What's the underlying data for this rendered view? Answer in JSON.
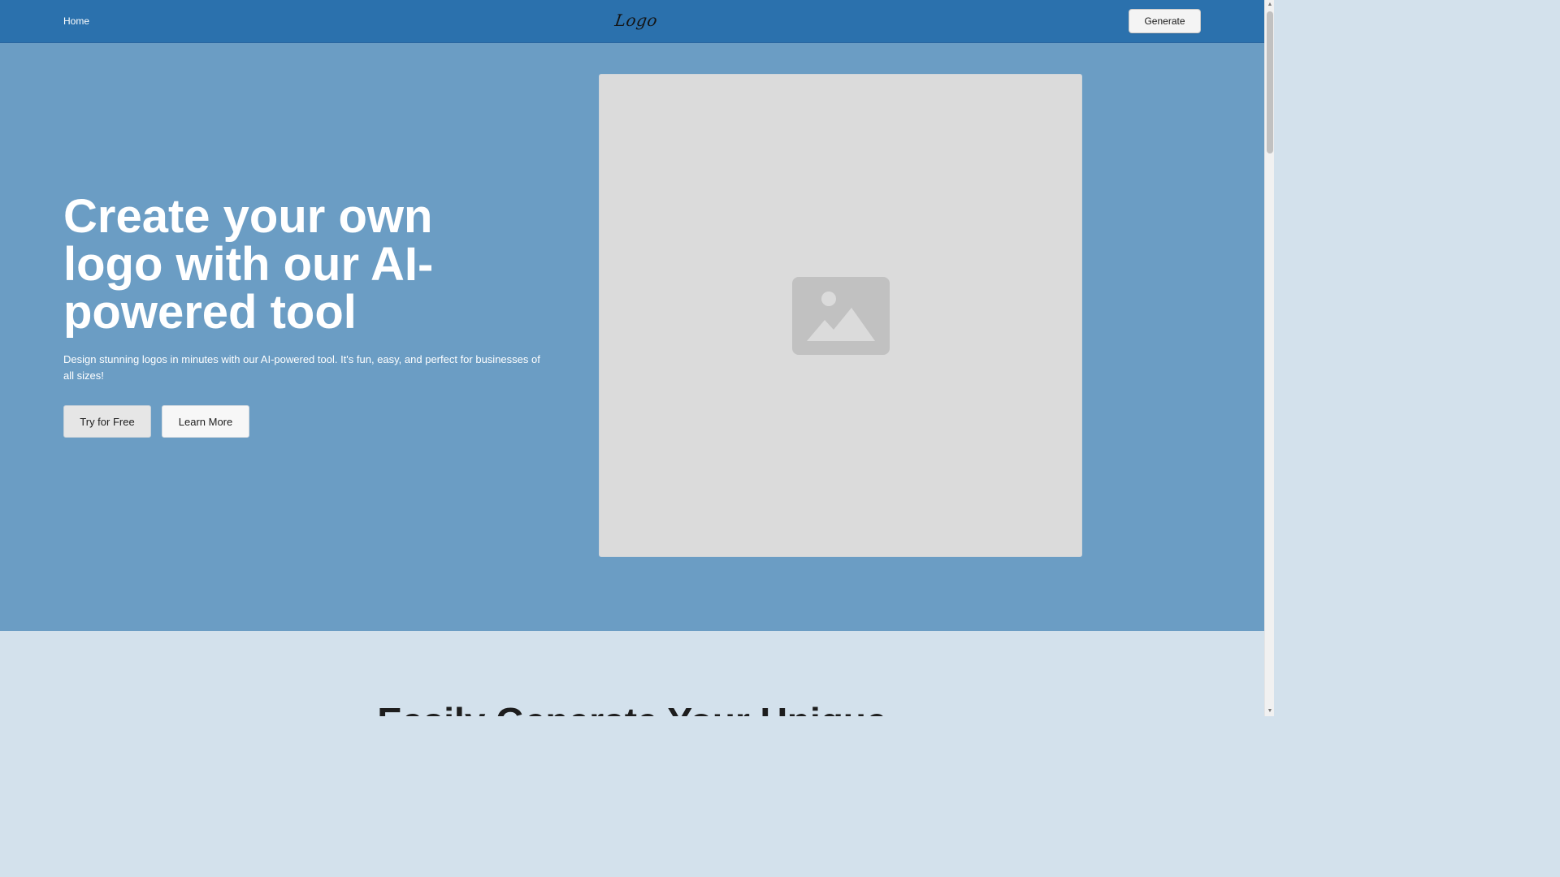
{
  "navbar": {
    "home_label": "Home",
    "logo_text": "Logo",
    "generate_label": "Generate"
  },
  "hero": {
    "title": "Create your own logo with our AI-powered tool",
    "subtitle": "Design stunning logos in minutes with our AI-powered tool. It's fun, easy, and perfect for businesses of all sizes!",
    "primary_button": "Try for Free",
    "secondary_button": "Learn More",
    "image_icon": "image-placeholder-icon"
  },
  "section2": {
    "title": "Easily Generate Your Unique"
  },
  "scrollbar": {
    "up_glyph": "▲",
    "down_glyph": "▼"
  },
  "colors": {
    "navbar_bg": "#2b71ad",
    "hero_bg": "#6b9dc4",
    "section2_bg": "#d3e1ec",
    "placeholder_bg": "#dbdbdb",
    "placeholder_icon": "#c1c1c1"
  }
}
